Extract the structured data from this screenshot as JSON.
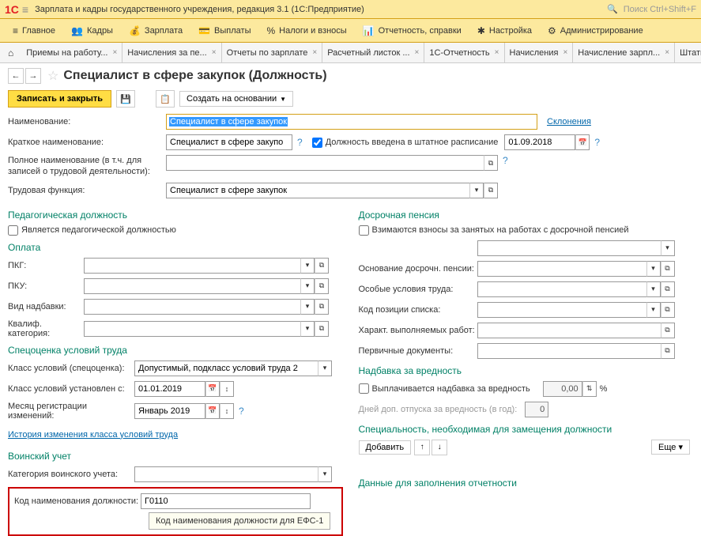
{
  "header": {
    "logo": "1C",
    "title": "Зарплата и кадры государственного учреждения, редакция 3.1  (1С:Предприятие)",
    "search_placeholder": "Поиск Ctrl+Shift+F"
  },
  "menu": {
    "main": "Главное",
    "kadry": "Кадры",
    "zarplata": "Зарплата",
    "vyplaty": "Выплаты",
    "nalogi": "Налоги и взносы",
    "otchet": "Отчетность, справки",
    "nastroika": "Настройка",
    "admin": "Администрирование"
  },
  "tabs": {
    "t1": "Приемы на работу...",
    "t2": "Начисления за пе...",
    "t3": "Отчеты по зарплате",
    "t4": "Расчетный листок ...",
    "t5": "1С-Отчетность",
    "t6": "Начисления",
    "t7": "Начисление зарпл...",
    "t8": "Штатное расписание"
  },
  "page": {
    "title": "Специалист в сфере закупок (Должность)"
  },
  "toolbar": {
    "save_close": "Записать и закрыть",
    "create_based": "Создать на основании"
  },
  "form": {
    "name_lbl": "Наименование:",
    "name_val": "Специалист в сфере закупок",
    "declension": "Склонения",
    "short_lbl": "Краткое наименование:",
    "short_val": "Специалист в сфере закупо",
    "intro_chk": "Должность введена в штатное расписание",
    "intro_date": "01.09.2018",
    "full_lbl": "Полное наименование (в т.ч. для записей о трудовой деятельности):",
    "full_val": "",
    "func_lbl": "Трудовая функция:",
    "func_val": "Специалист в сфере закупок"
  },
  "ped": {
    "hdr": "Педагогическая должность",
    "chk": "Является педагогической должностью"
  },
  "oplata": {
    "hdr": "Оплата",
    "pkg": "ПКГ:",
    "pku": "ПКУ:",
    "nadbavka": "Вид надбавки:",
    "kvalif": "Квалиф. категория:"
  },
  "spec": {
    "hdr": "Спецоценка условий труда",
    "klass_lbl": "Класс условий (спецоценка):",
    "klass_val": "Допустимый, подкласс условий труда 2",
    "ust_lbl": "Класс условий установлен с:",
    "ust_val": "01.01.2019",
    "mes_lbl": "Месяц регистрации изменений:",
    "mes_val": "Январь 2019",
    "history": "История изменения класса условий труда"
  },
  "voin": {
    "hdr": "Воинский учет",
    "kat_lbl": "Категория воинского учета:",
    "kod_lbl": "Код наименования должности:",
    "kod_val": "Г0110",
    "tooltip": "Код наименования должности для ЕФС-1"
  },
  "pension": {
    "hdr": "Досрочная пенсия",
    "chk": "Взимаются взносы за занятых на работах с досрочной пенсией",
    "osn": "Основание досрочн. пенсии:",
    "usl": "Особые условия труда:",
    "kod": "Код позиции списка:",
    "har": "Характ. выполняемых работ:",
    "perv": "Первичные документы:"
  },
  "nadb": {
    "hdr": "Надбавка за вредность",
    "chk": "Выплачивается надбавка за вредность",
    "perc": "0,00",
    "dop": "Дней доп. отпуска за вредность (в год):",
    "dop_val": "0"
  },
  "special": {
    "hdr": "Специальность, необходимая для замещения должности",
    "add": "Добавить",
    "more": "Еще"
  },
  "otch": {
    "hdr": "Данные для заполнения отчетности"
  }
}
